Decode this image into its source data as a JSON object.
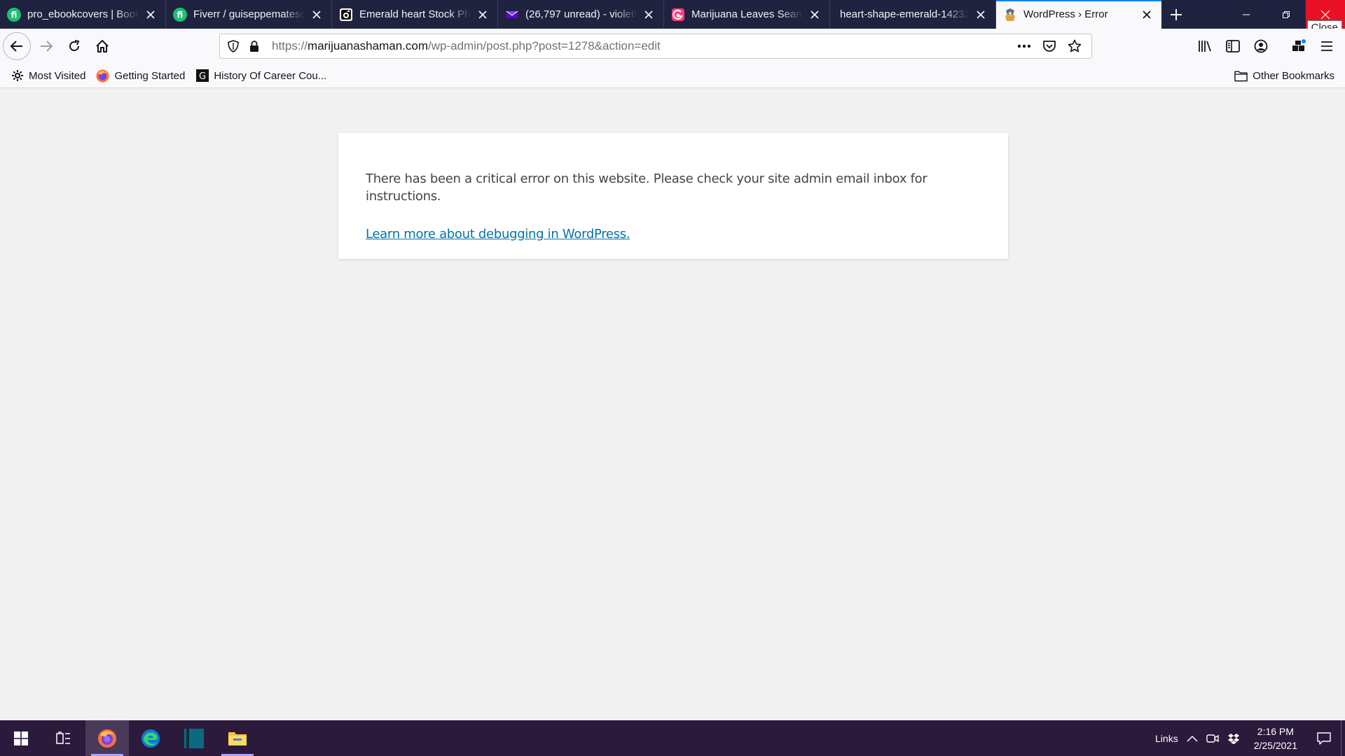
{
  "tabs": [
    {
      "title": "pro_ebookcovers | Book",
      "favicon": "fiverr-icon",
      "active": false
    },
    {
      "title": "Fiverr / guiseppematese",
      "favicon": "fiverr-icon",
      "active": false
    },
    {
      "title": "Emerald heart Stock Pho",
      "favicon": "stock-photo-icon",
      "active": false
    },
    {
      "title": "(26,797 unread) - violett",
      "favicon": "yahoo-mail-icon",
      "active": false
    },
    {
      "title": "Marijuana Leaves Seaml",
      "favicon": "pattern-site-icon",
      "active": false
    },
    {
      "title": "heart-shape-emerald-14232",
      "favicon": "",
      "active": false
    },
    {
      "title": "WordPress › Error",
      "favicon": "wordpress-error-icon",
      "active": true
    }
  ],
  "window": {
    "close_tooltip": "Close"
  },
  "urlbar": {
    "scheme": "https://",
    "domain": "marijuanashaman.com",
    "path": "/wp-admin/post.php?post=1278&action=edit"
  },
  "bookmarks": {
    "items": [
      {
        "label": "Most Visited",
        "icon": "gear-icon"
      },
      {
        "label": "Getting Started",
        "icon": "firefox-icon"
      },
      {
        "label": "History Of Career Cou...",
        "icon": "g-site-icon"
      }
    ],
    "other": "Other Bookmarks"
  },
  "page": {
    "message": "There has been a critical error on this website. Please check your site admin email inbox for instructions.",
    "link": "Learn more about debugging in WordPress."
  },
  "taskbar": {
    "tray_links": "Links",
    "time": "2:16 PM",
    "date": "2/25/2021"
  },
  "colors": {
    "tabstrip_bg": "#202340",
    "link": "#0073aa",
    "taskbar_bg": "#2c1a3c",
    "close_red": "#e81123"
  }
}
